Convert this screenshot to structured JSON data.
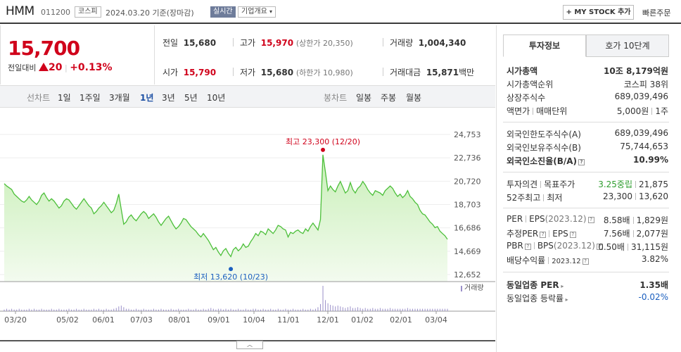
{
  "header": {
    "name": "HMM",
    "code": "011200",
    "market": "코스피",
    "date": "2024.03.20",
    "basis": "기준(장마감)",
    "realtime": "실시간",
    "company_info": "기업개요",
    "mystock": "+ MY STOCK 추가",
    "quick_order": "빠른주문"
  },
  "price": {
    "current": "15,700",
    "change_label": "전일대비",
    "change": "20",
    "change_pct": "+0.13%"
  },
  "summary": {
    "prev_label": "전일",
    "prev": "15,680",
    "high_label": "고가",
    "high": "15,970",
    "upper_limit": "(상한가 20,350)",
    "volume_label": "거래량",
    "volume": "1,004,340",
    "open_label": "시가",
    "open": "15,790",
    "low_label": "저가",
    "low": "15,680",
    "lower_limit": "(하한가 10,980)",
    "amount_label": "거래대금",
    "amount": "15,871",
    "amount_unit": "백만"
  },
  "periods": {
    "line_chart": "선차트",
    "items": [
      "1일",
      "1주일",
      "3개월",
      "1년",
      "3년",
      "5년",
      "10년"
    ],
    "selected": "1년",
    "candle_chart": "봉차트",
    "candle_items": [
      "일봉",
      "주봉",
      "월봉"
    ]
  },
  "tabs": {
    "invest_info": "투자정보",
    "quote10": "호가 10단계"
  },
  "invest": {
    "market_cap_label": "시가총액",
    "market_cap": "10조 8,179억원",
    "rank_label": "시가총액순위",
    "rank": "코스피 38위",
    "shares_label": "상장주식수",
    "shares": "689,039,496",
    "par_label": "액면가",
    "unit_label": "매매단위",
    "par": "5,000원",
    "unit": "1주",
    "foreign_limit_label": "외국인한도주식수(A)",
    "foreign_limit": "689,039,496",
    "foreign_hold_label": "외국인보유주식수(B)",
    "foreign_hold": "75,744,653",
    "foreign_ratio_label": "외국인소진율(B/A)",
    "foreign_ratio": "10.99%",
    "opinion_label": "투자의견",
    "target_label": "목표주가",
    "opinion": "3.25중립",
    "target": "21,875",
    "w52_label": "52주최고",
    "w52_low_label": "최저",
    "w52_high": "23,300",
    "w52_low": "13,620",
    "per_label": "PER",
    "eps_label": "EPS",
    "eps_year": "(2023.12)",
    "per": "8.58배",
    "eps": "1,829원",
    "eper_label": "추정PER",
    "eeps_label": "EPS",
    "eper": "7.56배",
    "eeps": "2,077원",
    "pbr_label": "PBR",
    "bps_label": "BPS",
    "bps_year": "(2023.12)",
    "pbr": "0.50배",
    "bps": "31,115원",
    "div_label": "배당수익률",
    "div_year": "2023.12",
    "div": "3.82%",
    "sector_per_label": "동일업종 PER",
    "sector_per": "1.35배",
    "sector_chg_label": "동일업종 등락률",
    "sector_chg": "-0.02%"
  },
  "colors": {
    "up": "#d0021b",
    "down": "#1b5fbf",
    "line": "#4cbf3a",
    "fill": "#dff5d3"
  },
  "icons": {
    "info": "info-box-icon",
    "arrow": "triangle-up-icon",
    "chevron": "chevron-down-icon",
    "collapse": "chevron-up-icon"
  },
  "chart_data": {
    "type": "area",
    "title": "",
    "xlabel": "",
    "ylabel": "",
    "y_ticks": [
      24753,
      22736,
      20720,
      18703,
      16686,
      14669,
      12652
    ],
    "y_tick_labels": [
      "24,753",
      "22,736",
      "20,720",
      "18,703",
      "16,686",
      "14,669",
      "12,652"
    ],
    "ylim": [
      12652,
      24753
    ],
    "x_tick_labels": [
      "03/20",
      "05/02",
      "06/01",
      "07/03",
      "08/01",
      "09/01",
      "10/04",
      "11/01",
      "12/01",
      "01/02",
      "02/01",
      "03/04"
    ],
    "high_annotation": "최고 23,300 (12/20)",
    "low_annotation": "최저 13,620 (10/23)",
    "high": {
      "date": "12/20",
      "value": 23300
    },
    "low": {
      "date": "10/23",
      "value": 13620
    },
    "volume_legend": "거래량",
    "series": [
      {
        "values": [
          20500,
          20300,
          20150,
          20000,
          19600,
          19400,
          19200,
          19000,
          18900,
          19100,
          19400,
          19100,
          18900,
          18700,
          19000,
          19500,
          19700,
          19300,
          19000,
          19200,
          19000,
          18700,
          18400,
          18600,
          19000,
          19200,
          19100,
          18800,
          18500,
          18300,
          18600,
          18900,
          19200,
          18900,
          18600,
          18400,
          17900,
          18100,
          18400,
          18600,
          18900,
          18600,
          18300,
          18000,
          18200,
          18800,
          19600,
          18300,
          17000,
          17200,
          17600,
          17800,
          17500,
          17300,
          17600,
          17900,
          18100,
          17900,
          17500,
          17700,
          17900,
          17600,
          17200,
          16900,
          17200,
          17500,
          17700,
          17300,
          16900,
          16600,
          16800,
          17100,
          17500,
          17400,
          17100,
          16800,
          16600,
          16400,
          16100,
          15900,
          16200,
          15900,
          15600,
          15200,
          14800,
          15000,
          14600,
          14300,
          14700,
          14900,
          14500,
          14200,
          14800,
          15000,
          14700,
          14900,
          15300,
          15000,
          15100,
          15500,
          15800,
          16200,
          16000,
          16400,
          16300,
          16100,
          16600,
          16400,
          16200,
          16500,
          16900,
          16800,
          16600,
          16500,
          15900,
          16300,
          16200,
          16400,
          16500,
          16300,
          16200,
          16600,
          16400,
          16800,
          17100,
          16800,
          16500,
          17400,
          23000,
          21500,
          19900,
          20300,
          20000,
          19800,
          20300,
          20700,
          20200,
          19700,
          19900,
          20600,
          20000,
          19700,
          20100,
          20300,
          20700,
          20400,
          20000,
          19700,
          19500,
          19900,
          19800,
          19700,
          19500,
          19900,
          20100,
          20300,
          20100,
          19700,
          19400,
          19600,
          19300,
          19500,
          19900,
          19400,
          19200,
          18900,
          18700,
          18200,
          17900,
          17800,
          17500,
          17200,
          17000,
          16700,
          16800,
          16400,
          16200,
          16000,
          15700
        ]
      }
    ],
    "volume": [
      2,
      3,
      2,
      3,
      2,
      2,
      3,
      2,
      2,
      2,
      3,
      2,
      3,
      2,
      2,
      3,
      2,
      2,
      2,
      3,
      2,
      2,
      3,
      2,
      2,
      2,
      3,
      2,
      2,
      3,
      2,
      2,
      3,
      2,
      2,
      2,
      3,
      2,
      3,
      2,
      2,
      3,
      2,
      2,
      3,
      4,
      6,
      7,
      5,
      3,
      3,
      2,
      2,
      3,
      2,
      2,
      3,
      2,
      2,
      2,
      3,
      2,
      2,
      3,
      2,
      2,
      2,
      3,
      2,
      2,
      3,
      2,
      2,
      2,
      3,
      2,
      2,
      3,
      2,
      2,
      3,
      2,
      3,
      4,
      3,
      2,
      3,
      3,
      2,
      3,
      2,
      3,
      2,
      2,
      3,
      2,
      2,
      3,
      2,
      2,
      3,
      3,
      2,
      2,
      3,
      2,
      2,
      3,
      2,
      2,
      3,
      2,
      2,
      3,
      2,
      2,
      3,
      2,
      2,
      2,
      3,
      2,
      2,
      3,
      2,
      3,
      5,
      9,
      32,
      14,
      10,
      8,
      7,
      6,
      7,
      6,
      5,
      4,
      5,
      6,
      4,
      4,
      5,
      4,
      3,
      4,
      3,
      3,
      4,
      3,
      3,
      4,
      3,
      3,
      3,
      4,
      3,
      3,
      3,
      3,
      3,
      3,
      4,
      3,
      3,
      3,
      3,
      3,
      3,
      3,
      3,
      3,
      3,
      3,
      3,
      3,
      3,
      3,
      3
    ]
  }
}
